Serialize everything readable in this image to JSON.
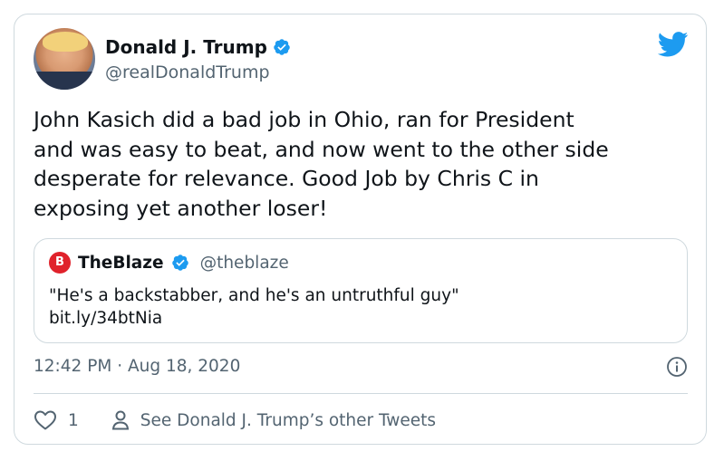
{
  "author": {
    "name": "Donald J. Trump",
    "handle": "@realDonaldTrump",
    "verified": true
  },
  "tweet": {
    "text": "John Kasich did a bad job in Ohio, ran for President\nand was easy to beat, and now went to the other side\ndesperate for relevance. Good Job by Chris C in\nexposing yet another loser!",
    "timestamp": "12:42 PM · Aug 18, 2020"
  },
  "quote": {
    "name": "TheBlaze",
    "handle": "@theblaze",
    "verified": true,
    "text": "\"He's a backstabber, and he's an untruthful guy\"\nbit.ly/34btNia"
  },
  "actions": {
    "like_count": "1",
    "other_tweets_label": "See Donald J. Trump’s other Tweets"
  },
  "colors": {
    "twitter_blue": "#1d9bf0",
    "secondary_text": "#536471",
    "border": "#cfd9de",
    "blaze_red": "#e0222b"
  },
  "icons": [
    "twitter-bird-icon",
    "verified-badge-icon",
    "info-icon",
    "heart-icon",
    "person-icon"
  ]
}
